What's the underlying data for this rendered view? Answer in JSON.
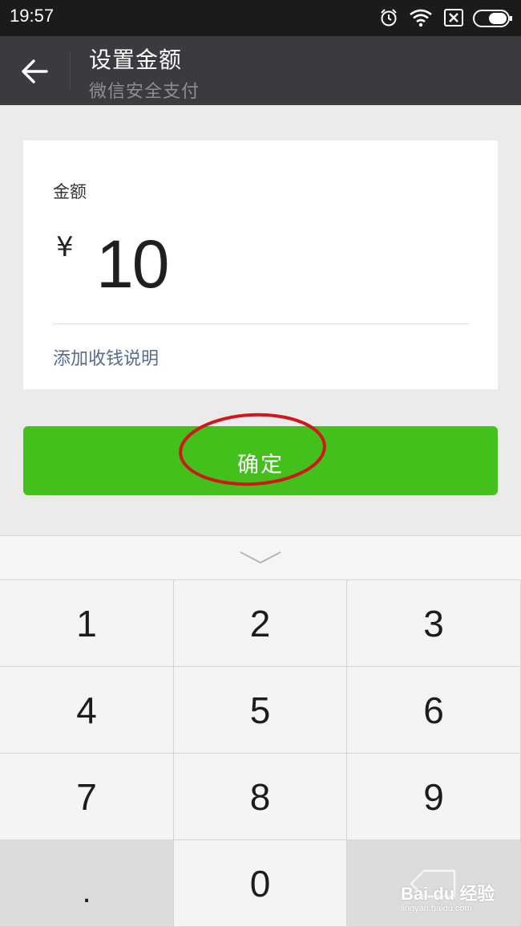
{
  "status_bar": {
    "time": "19:57"
  },
  "header": {
    "title": "设置金额",
    "subtitle": "微信安全支付"
  },
  "card": {
    "amount_label": "金额",
    "currency": "¥",
    "amount": "10",
    "add_note": "添加收钱说明"
  },
  "confirm_button": {
    "label": "确定"
  },
  "keypad": {
    "keys": [
      "1",
      "2",
      "3",
      "4",
      "5",
      "6",
      "7",
      "8",
      "9",
      ".",
      "0",
      ""
    ]
  },
  "watermark": {
    "brand": "Bai du 经验",
    "url": "jingyan.baidu.com"
  },
  "colors": {
    "accent": "#44c01d",
    "header": "#3a3b3f",
    "link": "#576b95",
    "annotation": "#d0171c"
  }
}
